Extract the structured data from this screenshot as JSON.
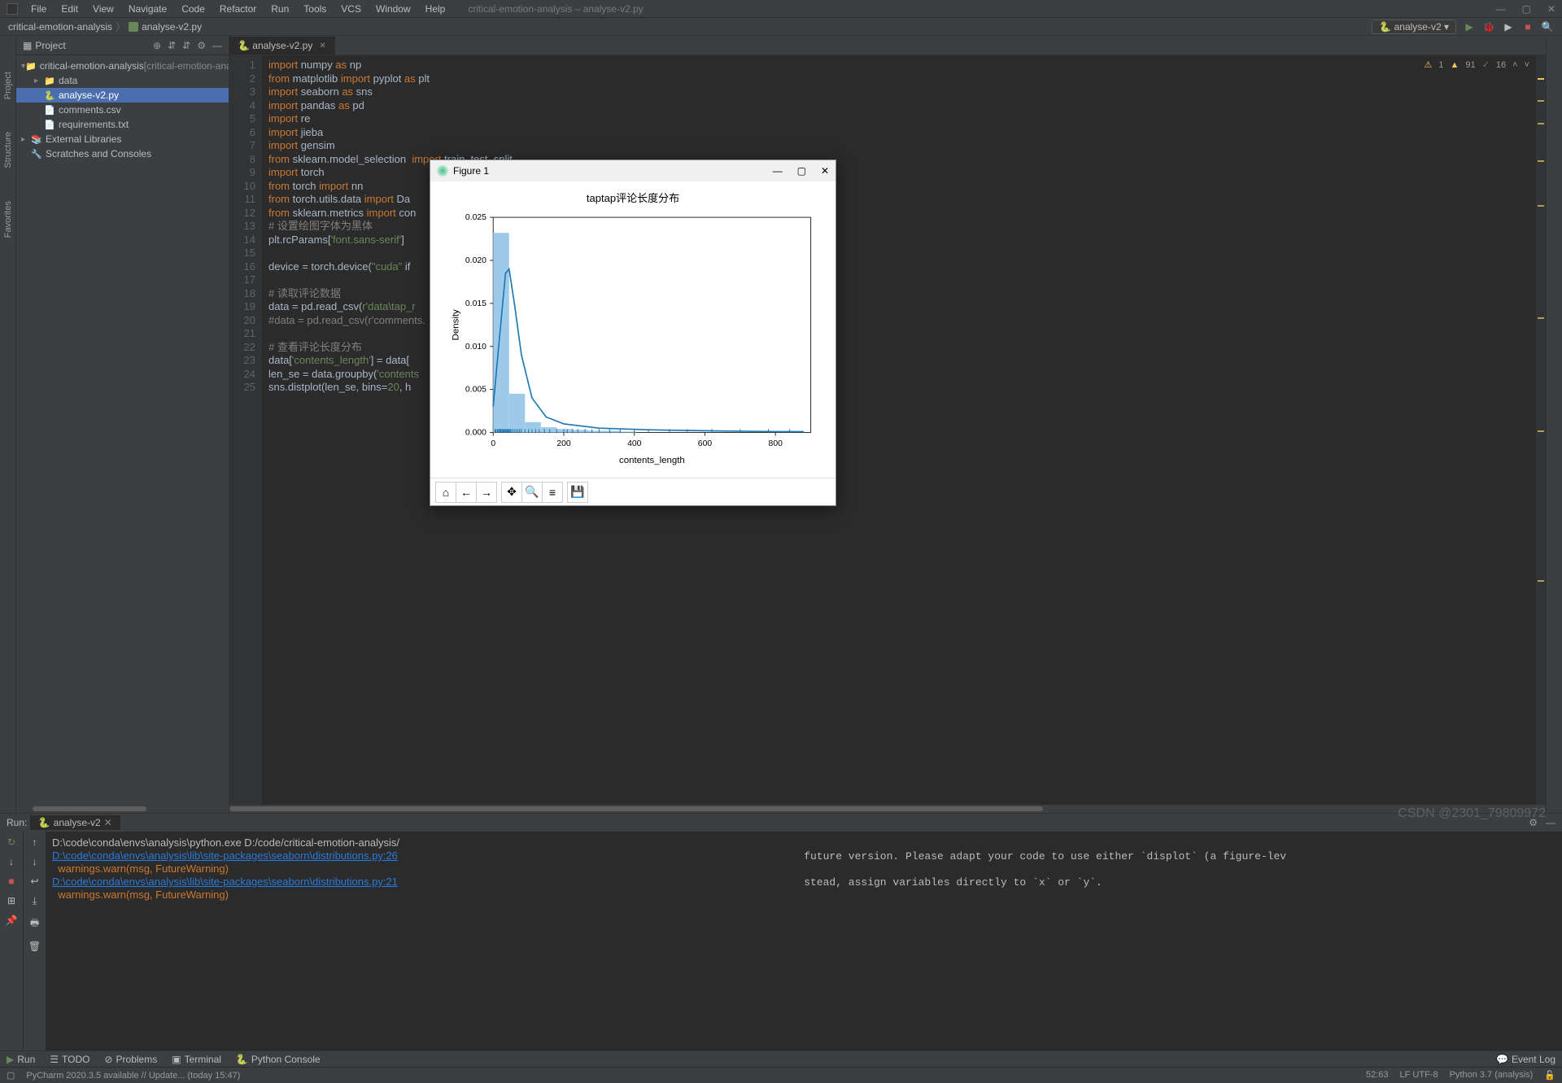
{
  "window": {
    "title": "critical-emotion-analysis – analyse-v2.py"
  },
  "menus": [
    "File",
    "Edit",
    "View",
    "Navigate",
    "Code",
    "Refactor",
    "Run",
    "Tools",
    "VCS",
    "Window",
    "Help"
  ],
  "breadcrumb": {
    "project": "critical-emotion-analysis",
    "file": "analyse-v2.py"
  },
  "runconfig": {
    "name": "analyse-v2"
  },
  "project_panel": {
    "title": "Project",
    "tree": [
      {
        "depth": 0,
        "arrow": "▾",
        "icon": "📁",
        "label": "critical-emotion-analysis",
        "suffix": "[critical-emotion-analysis]"
      },
      {
        "depth": 1,
        "arrow": "▸",
        "icon": "📁",
        "label": "data"
      },
      {
        "depth": 1,
        "arrow": "",
        "icon": "🐍",
        "label": "analyse-v2.py",
        "selected": true
      },
      {
        "depth": 1,
        "arrow": "",
        "icon": "📄",
        "label": "comments.csv"
      },
      {
        "depth": 1,
        "arrow": "",
        "icon": "📄",
        "label": "requirements.txt"
      },
      {
        "depth": 0,
        "arrow": "▸",
        "icon": "📚",
        "label": "External Libraries"
      },
      {
        "depth": 0,
        "arrow": "",
        "icon": "🔧",
        "label": "Scratches and Consoles"
      }
    ]
  },
  "left_tool_tabs": [
    "Project",
    "Structure",
    "Favorites"
  ],
  "inspections": {
    "warn": "1",
    "weak_warn": "91",
    "typo": "16"
  },
  "editor": {
    "tab": "analyse-v2.py",
    "lines": [
      {
        "n": 1,
        "html": "<span class='kw'>import</span> numpy <span class='kw'>as</span> np"
      },
      {
        "n": 2,
        "html": "<span class='kw'>from</span> matplotlib <span class='kw'>import</span> pyplot <span class='kw'>as</span> plt"
      },
      {
        "n": 3,
        "html": "<span class='kw'>import</span> seaborn <span class='kw'>as</span> sns"
      },
      {
        "n": 4,
        "html": "<span class='kw'>import</span> pandas <span class='kw'>as</span> pd"
      },
      {
        "n": 5,
        "html": "<span class='kw'>import</span> re"
      },
      {
        "n": 6,
        "html": "<span class='kw'>import</span> jieba"
      },
      {
        "n": 7,
        "html": "<span class='kw'>import</span> gensim"
      },
      {
        "n": 8,
        "html": "<span class='kw'>from</span> sklearn.model_selection  <span class='kw'>import</span> train_test_split"
      },
      {
        "n": 9,
        "html": "<span class='kw'>import</span> torch"
      },
      {
        "n": 10,
        "html": "<span class='kw'>from</span> torch <span class='kw'>import</span> nn"
      },
      {
        "n": 11,
        "html": "<span class='kw'>from</span> torch.utils.data <span class='kw'>import</span> Da"
      },
      {
        "n": 12,
        "html": "<span class='kw'>from</span> sklearn.metrics <span class='kw'>import</span> con"
      },
      {
        "n": 13,
        "html": "<span class='cmt'># 设置绘图字体为黑体</span>"
      },
      {
        "n": 14,
        "html": "plt.rcParams[<span class='str'>'font.sans-serif'</span>]"
      },
      {
        "n": 15,
        "html": ""
      },
      {
        "n": 16,
        "html": "device = torch.device(<span class='str'>\"cuda\"</span> if"
      },
      {
        "n": 17,
        "html": ""
      },
      {
        "n": 18,
        "html": "<span class='cmt'># 读取评论数据</span>"
      },
      {
        "n": 19,
        "html": "data = pd.read_csv(<span class='str'>r'data\\tap_r</span>"
      },
      {
        "n": 20,
        "html": "<span class='cmt'>#data = pd.read_csv(r'comments.</span>"
      },
      {
        "n": 21,
        "html": ""
      },
      {
        "n": 22,
        "html": "<span class='cmt'># 查看评论长度分布</span>"
      },
      {
        "n": 23,
        "html": "data[<span class='str'>'contents_length'</span>] = data["
      },
      {
        "n": 24,
        "html": "len_se = data.groupby(<span class='str'>'contents</span>"
      },
      {
        "n": 25,
        "html": "sns.distplot(len_se, <span class='fn'>bins</span>=<span class='str'>20</span>, h"
      }
    ]
  },
  "run": {
    "label": "Run:",
    "tab": "analyse-v2",
    "lines": [
      {
        "cls": "",
        "text": "D:\\code\\conda\\envs\\analysis\\python.exe D:/code/critical-emotion-analysis/"
      },
      {
        "cls": "link",
        "text": "D:\\code\\conda\\envs\\analysis\\lib\\site-packages\\seaborn\\distributions.py:26"
      },
      {
        "cls": "warn",
        "text": "  warnings.warn(msg, FutureWarning)"
      },
      {
        "cls": "link",
        "text": "D:\\code\\conda\\envs\\analysis\\lib\\site-packages\\seaborn\\distributions.py:21"
      },
      {
        "cls": "warn",
        "text": "  warnings.warn(msg, FutureWarning)"
      }
    ],
    "cut_right": [
      "future version. Please adapt your code to use either `displot` (a figure-lev",
      "stead, assign variables directly to `x` or `y`."
    ]
  },
  "bottom_tabs": {
    "run": "Run",
    "todo": "TODO",
    "problems": "Problems",
    "terminal": "Terminal",
    "python_console": "Python Console",
    "event_log": "Event Log"
  },
  "status": {
    "msg": "PyCharm 2020.3.5 available // Update... (today 15:47)",
    "pos": "52:63",
    "enc": "LF  UTF-8",
    "interp": "Python 3.7 (analysis)"
  },
  "figure": {
    "title": "Figure 1",
    "toolbar_icons": [
      "home-icon",
      "back-icon",
      "forward-icon",
      "pan-icon",
      "zoom-icon",
      "configure-icon",
      "save-icon"
    ]
  },
  "chart_data": {
    "type": "histogram_kde",
    "title": "taptap评论长度分布",
    "xlabel": "contents_length",
    "ylabel": "Density",
    "xlim": [
      0,
      900
    ],
    "ylim": [
      0,
      0.025
    ],
    "xticks": [
      0,
      200,
      400,
      600,
      800
    ],
    "yticks": [
      0.0,
      0.005,
      0.01,
      0.015,
      0.02,
      0.025
    ],
    "histogram": {
      "bin_width": 45,
      "bars": [
        {
          "x0": 0,
          "x1": 45,
          "density": 0.0232
        },
        {
          "x0": 45,
          "x1": 90,
          "density": 0.0045
        },
        {
          "x0": 90,
          "x1": 135,
          "density": 0.0012
        },
        {
          "x0": 135,
          "x1": 180,
          "density": 0.0006
        },
        {
          "x0": 180,
          "x1": 225,
          "density": 0.0004
        },
        {
          "x0": 225,
          "x1": 270,
          "density": 0.0003
        },
        {
          "x0": 270,
          "x1": 315,
          "density": 0.0002
        },
        {
          "x0": 315,
          "x1": 360,
          "density": 0.0002
        },
        {
          "x0": 360,
          "x1": 405,
          "density": 0.0001
        }
      ]
    },
    "kde": [
      {
        "x": 0,
        "y": 0.003
      },
      {
        "x": 20,
        "y": 0.012
      },
      {
        "x": 35,
        "y": 0.0185
      },
      {
        "x": 45,
        "y": 0.019
      },
      {
        "x": 60,
        "y": 0.015
      },
      {
        "x": 80,
        "y": 0.009
      },
      {
        "x": 110,
        "y": 0.004
      },
      {
        "x": 150,
        "y": 0.0018
      },
      {
        "x": 200,
        "y": 0.001
      },
      {
        "x": 300,
        "y": 0.0005
      },
      {
        "x": 450,
        "y": 0.0003
      },
      {
        "x": 600,
        "y": 0.0002
      },
      {
        "x": 800,
        "y": 0.0001
      },
      {
        "x": 880,
        "y": 0.0001
      }
    ],
    "rug": [
      5,
      8,
      12,
      15,
      18,
      20,
      22,
      25,
      28,
      30,
      32,
      35,
      38,
      40,
      42,
      45,
      48,
      50,
      55,
      60,
      65,
      70,
      75,
      80,
      90,
      100,
      110,
      120,
      130,
      145,
      160,
      180,
      200,
      210,
      225,
      240,
      260,
      280,
      300,
      330,
      360,
      400,
      440,
      500,
      550,
      620,
      700,
      780,
      840
    ]
  },
  "watermark": "CSDN @2301_79809972"
}
